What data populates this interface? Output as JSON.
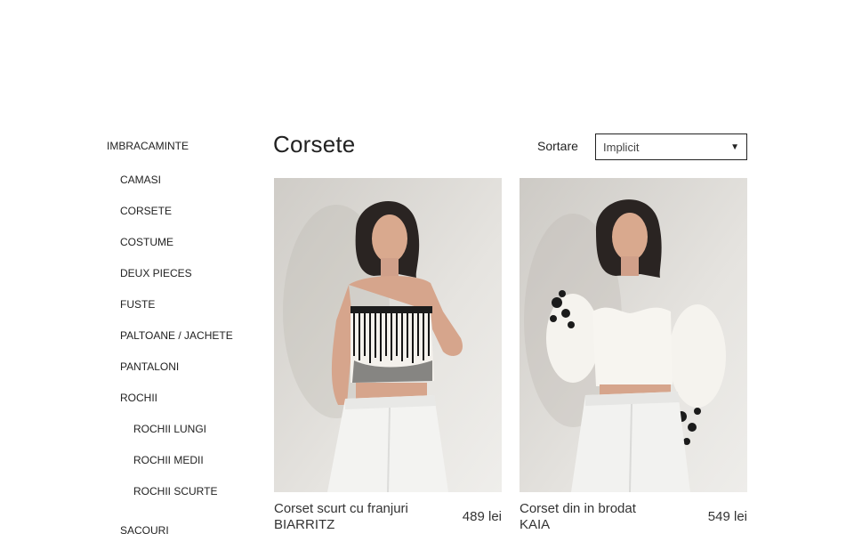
{
  "sidebar": {
    "top_category": "IMBRACAMINTE",
    "items": [
      {
        "label": "CAMASI"
      },
      {
        "label": "CORSETE"
      },
      {
        "label": "COSTUME"
      },
      {
        "label": "DEUX PIECES"
      },
      {
        "label": "FUSTE"
      },
      {
        "label": "PALTOANE / JACHETE"
      },
      {
        "label": "PANTALONI"
      },
      {
        "label": "ROCHII"
      }
    ],
    "sub_items": [
      {
        "label": "ROCHII LUNGI"
      },
      {
        "label": "ROCHII MEDII"
      },
      {
        "label": "ROCHII SCURTE"
      }
    ],
    "after_items": [
      {
        "label": "SACOURI"
      }
    ]
  },
  "main": {
    "title": "Corsete",
    "sort_label": "Sortare",
    "sort_value": "Implicit"
  },
  "products": [
    {
      "name_line1": "Corset scurt cu franjuri",
      "name_line2": "BIARRITZ",
      "price": "489 lei"
    },
    {
      "name_line1": "Corset din in brodat",
      "name_line2": "KAIA",
      "price": "549 lei"
    }
  ],
  "colors": {
    "text": "#222222",
    "background": "#ffffff"
  }
}
